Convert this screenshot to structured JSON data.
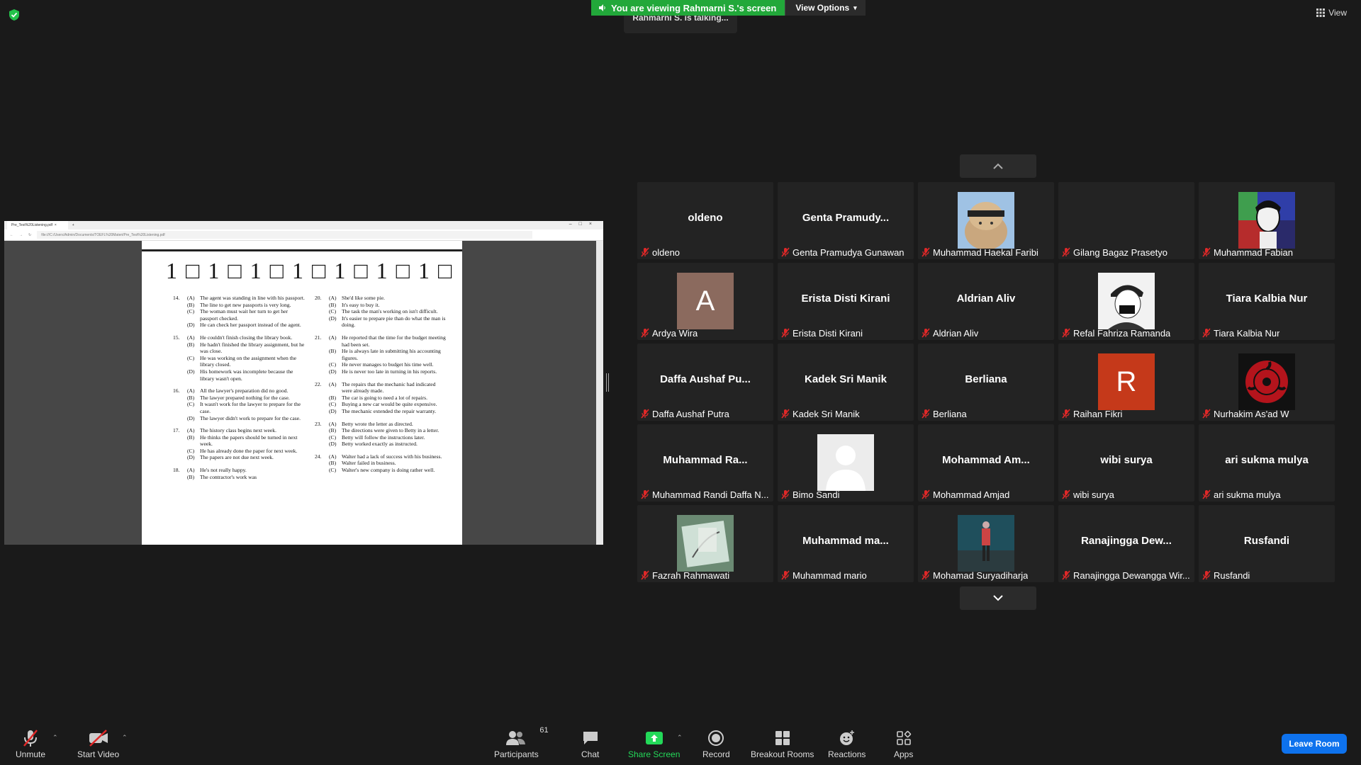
{
  "banner": {
    "viewing": "You are viewing Rahmarni S.'s screen",
    "view_options": "View Options",
    "talking": "Rahmarni S. is talking...",
    "view": "View"
  },
  "browser": {
    "tab": "Pre_Test%20Listening.pdf",
    "url": "file:///C:/Users/Admin/Documents/TOEFL%20Materi/Pre_Test%20Listening.pdf"
  },
  "document": {
    "header": "1□1□1□1□1□1□1□1",
    "left_questions": [
      {
        "num": "14.",
        "options": [
          [
            "(A)",
            "The agent was standing in line with his passport."
          ],
          [
            "(B)",
            "The line to get new passports is very long."
          ],
          [
            "(C)",
            "The woman must wait her turn to get her passport checked."
          ],
          [
            "(D)",
            "He can check her passport instead of the agent."
          ]
        ]
      },
      {
        "num": "15.",
        "options": [
          [
            "(A)",
            "He couldn't finish closing the library book."
          ],
          [
            "(B)",
            "He hadn't finished the library assignment, but he was close."
          ],
          [
            "(C)",
            "He was working on the assignment when the library closed."
          ],
          [
            "(D)",
            "His homework was incomplete because the library wasn't open."
          ]
        ]
      },
      {
        "num": "16.",
        "options": [
          [
            "(A)",
            "All the lawyer's preparation did no good."
          ],
          [
            "(B)",
            "The lawyer prepared nothing for the case."
          ],
          [
            "(C)",
            "It wasn't work for the lawyer to prepare for the case."
          ],
          [
            "(D)",
            "The lawyer didn't work to prepare for the case."
          ]
        ]
      },
      {
        "num": "17.",
        "options": [
          [
            "(A)",
            "The history class begins next week."
          ],
          [
            "(B)",
            "He thinks the papers should be turned in next week."
          ],
          [
            "(C)",
            "He has already done the paper for next week."
          ],
          [
            "(D)",
            "The papers are not due next week."
          ]
        ]
      },
      {
        "num": "18.",
        "options": [
          [
            "(A)",
            "He's not really happy."
          ],
          [
            "(B)",
            "The contractor's work was"
          ]
        ]
      }
    ],
    "right_questions": [
      {
        "num": "20.",
        "options": [
          [
            "(A)",
            "She'd like some pie."
          ],
          [
            "(B)",
            "It's easy to buy it."
          ],
          [
            "(C)",
            "The task the man's working on isn't difficult."
          ],
          [
            "(D)",
            "It's easier to prepare pie than do what the man is doing."
          ]
        ]
      },
      {
        "num": "21.",
        "options": [
          [
            "(A)",
            "He reported that the time for the budget meeting had been set."
          ],
          [
            "(B)",
            "He is always late in submitting his accounting figures."
          ],
          [
            "(C)",
            "He never manages to budget his time well."
          ],
          [
            "(D)",
            "He is never too late in turning in his reports."
          ]
        ]
      },
      {
        "num": "22.",
        "options": [
          [
            "(A)",
            "The repairs that the mechanic had indicated were already made."
          ],
          [
            "(B)",
            "The car is going to need a lot of repairs."
          ],
          [
            "(C)",
            "Buying a new car would be quite expensive."
          ],
          [
            "(D)",
            "The mechanic extended the repair warranty."
          ]
        ]
      },
      {
        "num": "23.",
        "options": [
          [
            "(A)",
            "Betty wrote the letter as directed."
          ],
          [
            "(B)",
            "The directions were given to Betty in a letter."
          ],
          [
            "(C)",
            "Betty will follow the instructions later."
          ],
          [
            "(D)",
            "Betty worked exactly as instructed."
          ]
        ]
      },
      {
        "num": "24.",
        "options": [
          [
            "(A)",
            "Walter had a lack of success with his business."
          ],
          [
            "(B)",
            "Walter failed in business."
          ],
          [
            "(C)",
            "Walter's new company is doing rather well."
          ]
        ]
      }
    ]
  },
  "participants": [
    {
      "big": "oldeno",
      "name": "oldeno",
      "avatar": "none"
    },
    {
      "big": "Genta  Pramudy...",
      "name": "Genta Pramudya Gunawan",
      "avatar": "none"
    },
    {
      "big": "",
      "name": "Muhammad Haekal Faribi",
      "avatar": "cat"
    },
    {
      "big": "",
      "name": "Gilang Bagaz Prasetyo",
      "avatar": "blank"
    },
    {
      "big": "",
      "name": "Muhammad Fabian",
      "avatar": "portrait"
    },
    {
      "big": "",
      "name": "Ardya Wira",
      "avatar": "letter",
      "letter": "A",
      "color": "#8b6a5e"
    },
    {
      "big": "Erista Disti Kirani",
      "name": "Erista Disti Kirani",
      "avatar": "none"
    },
    {
      "big": "Aldrian Aliv",
      "name": "Aldrian Aliv",
      "avatar": "none"
    },
    {
      "big": "",
      "name": "Refal Fahriza Ramanda",
      "avatar": "sketch"
    },
    {
      "big": "Tiara Kalbia Nur",
      "name": "Tiara Kalbia Nur",
      "avatar": "none"
    },
    {
      "big": "Daffa Aushaf Pu...",
      "name": "Daffa Aushaf Putra",
      "avatar": "none"
    },
    {
      "big": "Kadek Sri Manik",
      "name": "Kadek Sri Manik",
      "avatar": "none"
    },
    {
      "big": "Berliana",
      "name": "Berliana",
      "avatar": "none"
    },
    {
      "big": "",
      "name": "Raihan Fikri",
      "avatar": "letter",
      "letter": "R",
      "color": "#c5391a"
    },
    {
      "big": "",
      "name": "Nurhakim As'ad W",
      "avatar": "sharingan"
    },
    {
      "big": "Muhammad  Ra...",
      "name": "Muhammad Randi Daffa N...",
      "avatar": "none"
    },
    {
      "big": "",
      "name": "Bimo Sandi",
      "avatar": "default"
    },
    {
      "big": "Mohammad  Am...",
      "name": "Mohammad Amjad",
      "avatar": "none"
    },
    {
      "big": "wibi surya",
      "name": "wibi surya",
      "avatar": "none"
    },
    {
      "big": "ari sukma mulya",
      "name": "ari sukma mulya",
      "avatar": "none"
    },
    {
      "big": "",
      "name": "Fazrah Rahmawati",
      "avatar": "book"
    },
    {
      "big": "Muhammad  ma...",
      "name": "Muhammad mario",
      "avatar": "none"
    },
    {
      "big": "",
      "name": "Mohamad Suryadiharja",
      "avatar": "photo"
    },
    {
      "big": "Ranajingga  Dew...",
      "name": "Ranajingga Dewangga Wir...",
      "avatar": "none"
    },
    {
      "big": "Rusfandi",
      "name": "Rusfandi",
      "avatar": "none"
    }
  ],
  "toolbar": {
    "unmute": "Unmute",
    "start_video": "Start Video",
    "participants": "Participants",
    "participant_count": "61",
    "chat": "Chat",
    "share_screen": "Share Screen",
    "record": "Record",
    "breakout_rooms": "Breakout Rooms",
    "reactions": "Reactions",
    "apps": "Apps",
    "leave_room": "Leave Room"
  },
  "colors": {
    "banner_green": "#22a83a",
    "leave_blue": "#0e72ed",
    "muted_red": "#e02828",
    "share_green": "#23d959"
  }
}
